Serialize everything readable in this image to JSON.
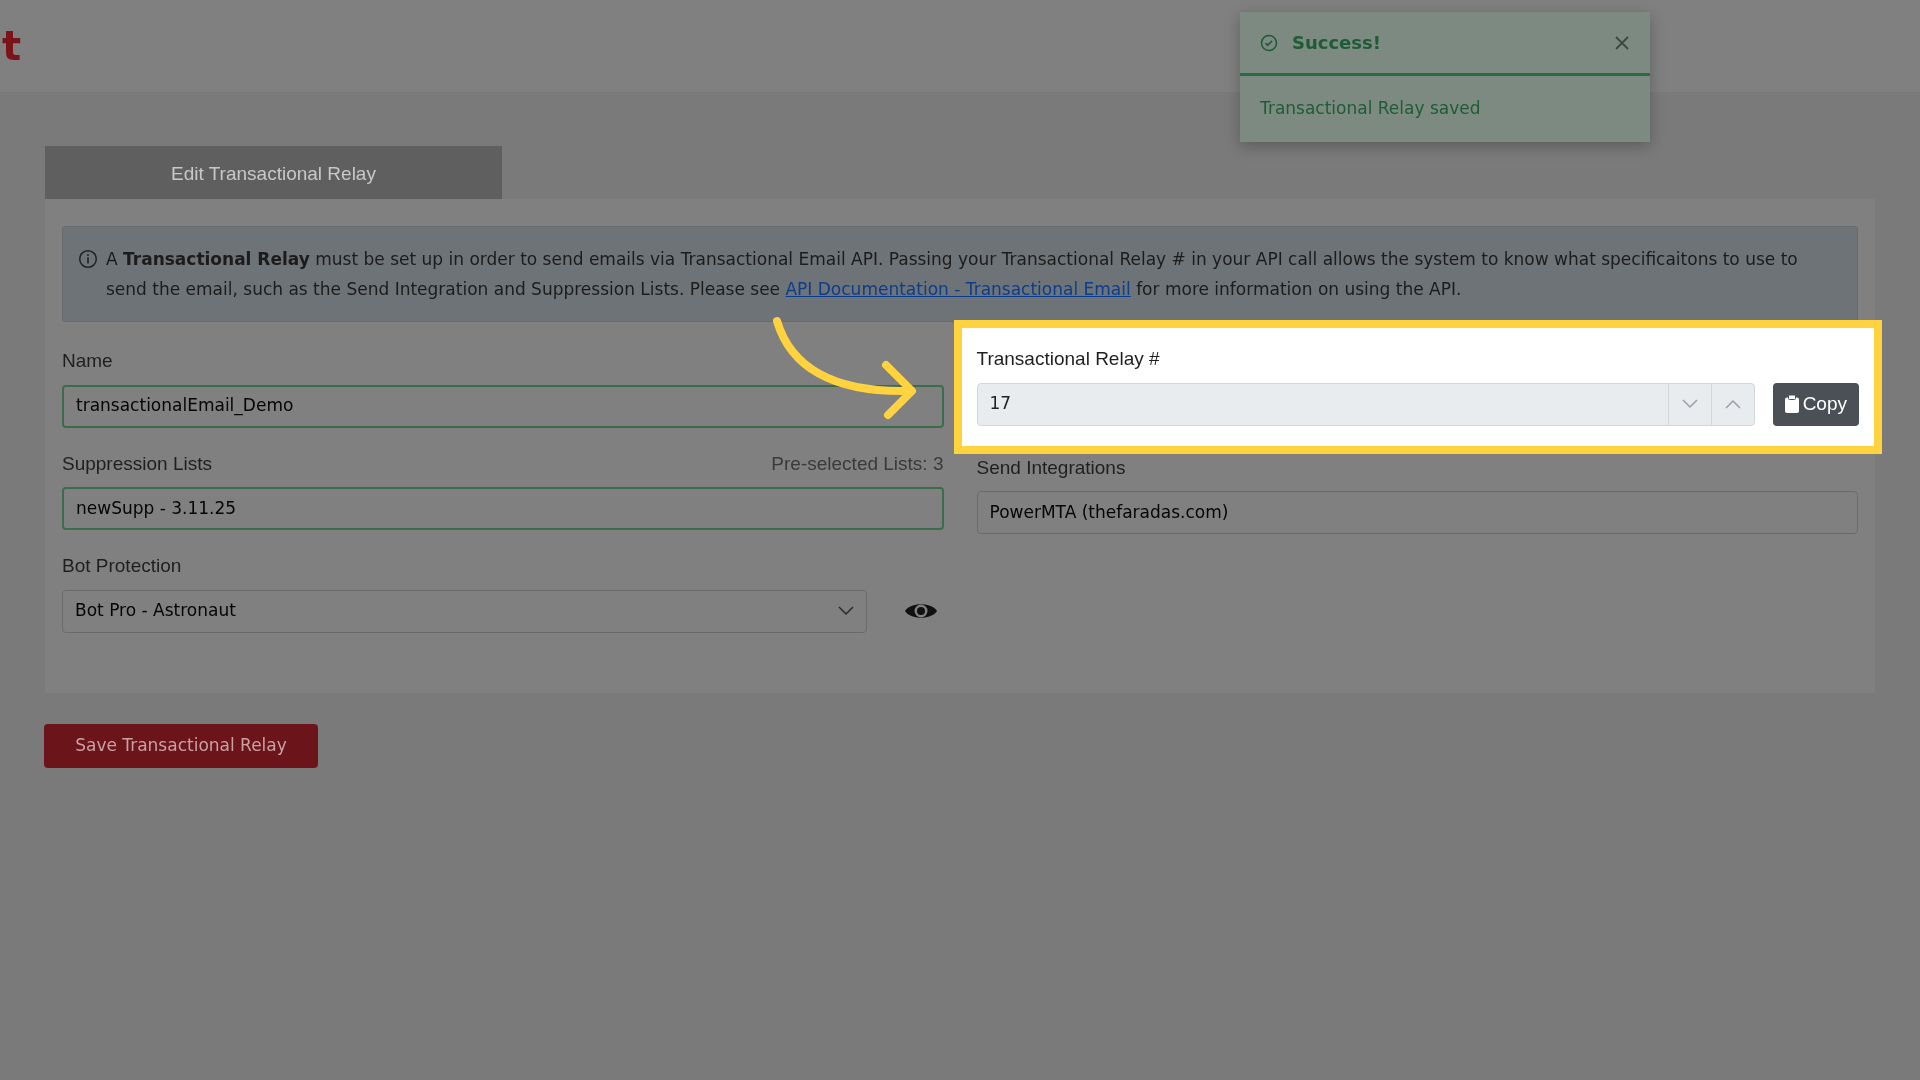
{
  "header": {
    "logo": "t"
  },
  "toast": {
    "title": "Success!",
    "message": "Transactional Relay saved"
  },
  "tab": {
    "label": "Edit Transactional Relay",
    "selected": true
  },
  "alert": {
    "text": "A **Transactional Relay** must be set up in order to send emails via Transactional Email API. Passing your Transactional Relay # in your API call allows the system to know what specificaitons to use to send the email, such as the Send Integration and Suppression Lists. Please see",
    "link": "API Documentation - Transactional Email",
    "text_after": "for more information on using the API."
  },
  "name": {
    "label": "Name",
    "value": "transactionalEmail_Demo",
    "valid": true
  },
  "relay": {
    "label": "Transactional Relay #",
    "value": "17",
    "copy_button": "Copy",
    "highlighted": true
  },
  "suppression": {
    "label": "Suppression Lists",
    "hint": "Pre-selected Lists: 3",
    "value": "newSupp - 3.11.25",
    "valid": true
  },
  "send_integrations": {
    "label": "Send Integrations",
    "value": "PowerMTA (thefaradas.com)"
  },
  "bot_protection": {
    "label": "Bot Protection",
    "value": "Bot Pro - Astronaut"
  },
  "save_button": "Save Transactional Relay"
}
